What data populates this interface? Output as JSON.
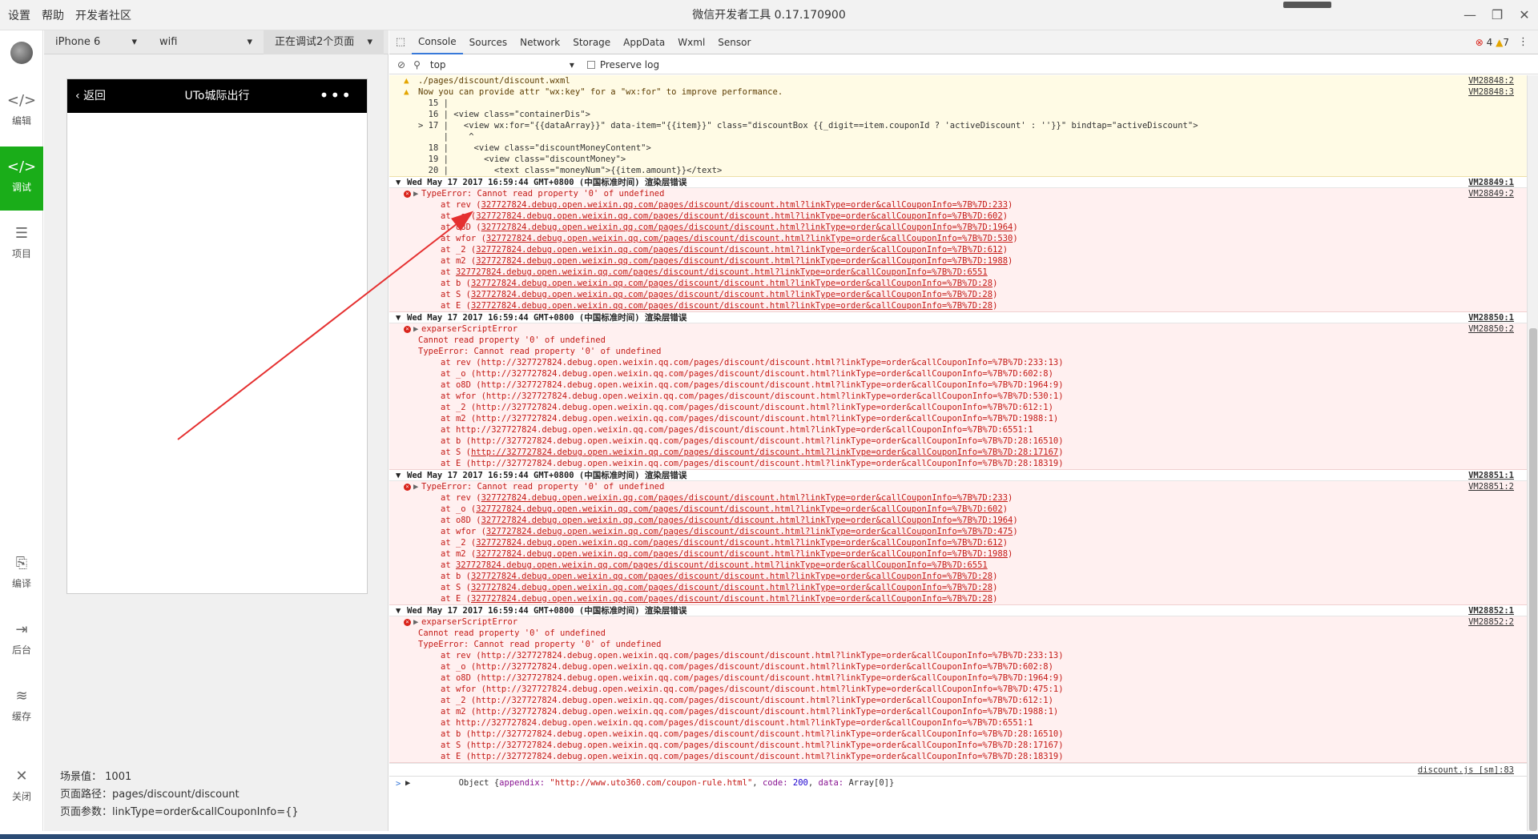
{
  "titlebar": {
    "menu": [
      "设置",
      "帮助",
      "开发者社区"
    ],
    "title": "微信开发者工具 0.17.170900"
  },
  "sidebar": {
    "items": [
      {
        "label": "编辑",
        "icon": "code-icon"
      },
      {
        "label": "调试",
        "icon": "debug-icon",
        "active": true
      },
      {
        "label": "项目",
        "icon": "menu-icon"
      },
      {
        "label": "编译",
        "icon": "compile-icon"
      },
      {
        "label": "后台",
        "icon": "background-icon"
      },
      {
        "label": "缓存",
        "icon": "layers-icon"
      },
      {
        "label": "关闭",
        "icon": "close-icon"
      }
    ]
  },
  "simulator": {
    "device": "iPhone 6",
    "network": "wifi",
    "debug_pages": "正在调试2个页面",
    "nav_back": "返回",
    "nav_title": "UTo城际出行",
    "nav_more": "•••",
    "scene_label": "场景值：",
    "scene_value": "1001",
    "path_label": "页面路径：",
    "path_value": "pages/discount/discount",
    "params_label": "页面参数：",
    "params_value": "linkType=order&callCouponInfo={}"
  },
  "devtools": {
    "tabs": [
      "Console",
      "Sources",
      "Network",
      "Storage",
      "AppData",
      "Wxml",
      "Sensor"
    ],
    "errors": "4",
    "warnings": "7",
    "filter_context": "top",
    "preserve_log": "Preserve log"
  },
  "console": {
    "warn_file": "./pages/discount/discount.wxml",
    "warn_src1": "VM28848:2",
    "warn_msg": "Now you can provide attr \"wx:key\" for a \"wx:for\" to improve performance.",
    "warn_src2": "VM28848:3",
    "code": [
      "  15 |",
      "  16 | <view class=\"containerDis\">",
      "> 17 |   <view wx:for=\"{{dataArray}}\" data-item=\"{{item}}\" class=\"discountBox {{_digit==item.couponId ? 'activeDiscount' : ''}}\" bindtap=\"activeDiscount\">",
      "     |    ^",
      "  18 |     <view class=\"discountMoneyContent\">",
      "  19 |       <view class=\"discountMoney\">",
      "  20 |         <text class=\"moneyNum\">{{item.amount}}</text>"
    ],
    "groups": [
      {
        "header": "Wed May 17 2017 16:59:44 GMT+0800 (中国标准时间) 渲染层错误",
        "hsrc": "VM28849:1",
        "esrc": "VM28849:2",
        "title": "TypeError: Cannot read property '0' of undefined",
        "extra": [],
        "stack": [
          [
            "at rev (",
            "327727824.debug.open.weixin.qq.com/pages/discount/discount.html?linkType=order&callCouponInfo=%7B%7D:233",
            ")"
          ],
          [
            "at _o (",
            "327727824.debug.open.weixin.qq.com/pages/discount/discount.html?linkType=order&callCouponInfo=%7B%7D:602",
            ")"
          ],
          [
            "at o8D (",
            "327727824.debug.open.weixin.qq.com/pages/discount/discount.html?linkType=order&callCouponInfo=%7B%7D:1964",
            ")"
          ],
          [
            "at wfor (",
            "327727824.debug.open.weixin.qq.com/pages/discount/discount.html?linkType=order&callCouponInfo=%7B%7D:530",
            ")"
          ],
          [
            "at _2 (",
            "327727824.debug.open.weixin.qq.com/pages/discount/discount.html?linkType=order&callCouponInfo=%7B%7D:612",
            ")"
          ],
          [
            "at m2 (",
            "327727824.debug.open.weixin.qq.com/pages/discount/discount.html?linkType=order&callCouponInfo=%7B%7D:1988",
            ")"
          ],
          [
            "at ",
            "327727824.debug.open.weixin.qq.com/pages/discount/discount.html?linkType=order&callCouponInfo=%7B%7D:6551",
            ""
          ],
          [
            "at b (",
            "327727824.debug.open.weixin.qq.com/pages/discount/discount.html?linkType=order&callCouponInfo=%7B%7D:28",
            ")"
          ],
          [
            "at S (",
            "327727824.debug.open.weixin.qq.com/pages/discount/discount.html?linkType=order&callCouponInfo=%7B%7D:28",
            ")"
          ],
          [
            "at E (",
            "327727824.debug.open.weixin.qq.com/pages/discount/discount.html?linkType=order&callCouponInfo=%7B%7D:28",
            ")"
          ]
        ]
      },
      {
        "header": "Wed May 17 2017 16:59:44 GMT+0800 (中国标准时间) 渲染层错误",
        "hsrc": "VM28850:1",
        "esrc": "VM28850:2",
        "title": "exparserScriptError",
        "extra": [
          "Cannot read property '0' of undefined",
          "TypeError: Cannot read property '0' of undefined"
        ],
        "stack": [
          [
            "at rev (http://327727824.debug.open.weixin.qq.com/pages/discount/discount.html?linkType=order&callCouponInfo=%7B%7D:233:13)",
            "",
            ""
          ],
          [
            "at _o (http://327727824.debug.open.weixin.qq.com/pages/discount/discount.html?linkType=order&callCouponInfo=%7B%7D:602:8)",
            "",
            ""
          ],
          [
            "at o8D (http://327727824.debug.open.weixin.qq.com/pages/discount/discount.html?linkType=order&callCouponInfo=%7B%7D:1964:9)",
            "",
            ""
          ],
          [
            "at wfor (http://327727824.debug.open.weixin.qq.com/pages/discount/discount.html?linkType=order&callCouponInfo=%7B%7D:530:1)",
            "",
            ""
          ],
          [
            "at _2 (http://327727824.debug.open.weixin.qq.com/pages/discount/discount.html?linkType=order&callCouponInfo=%7B%7D:612:1)",
            "",
            ""
          ],
          [
            "at m2 (http://327727824.debug.open.weixin.qq.com/pages/discount/discount.html?linkType=order&callCouponInfo=%7B%7D:1988:1)",
            "",
            ""
          ],
          [
            "at http://327727824.debug.open.weixin.qq.com/pages/discount/discount.html?linkType=order&callCouponInfo=%7B%7D:6551:1",
            "",
            ""
          ],
          [
            "at b (http://327727824.debug.open.weixin.qq.com/pages/discount/discount.html?linkType=order&callCouponInfo=%7B%7D:28:16510)",
            "",
            ""
          ],
          [
            "at S (",
            "http://327727824.debug.open.weixin.qq.com/pages/discount/discount.html?linkType=order&callCouponInfo=%7B%7D:28:17167",
            ")"
          ],
          [
            "at E (http://327727824.debug.open.weixin.qq.com/pages/discount/discount.html?linkType=order&callCouponInfo=%7B%7D:28:18319)",
            "",
            ""
          ]
        ]
      },
      {
        "header": "Wed May 17 2017 16:59:44 GMT+0800 (中国标准时间) 渲染层错误",
        "hsrc": "VM28851:1",
        "esrc": "VM28851:2",
        "title": "TypeError: Cannot read property '0' of undefined",
        "extra": [],
        "stack": [
          [
            "at rev (",
            "327727824.debug.open.weixin.qq.com/pages/discount/discount.html?linkType=order&callCouponInfo=%7B%7D:233",
            ")"
          ],
          [
            "at _o (",
            "327727824.debug.open.weixin.qq.com/pages/discount/discount.html?linkType=order&callCouponInfo=%7B%7D:602",
            ")"
          ],
          [
            "at o8D (",
            "327727824.debug.open.weixin.qq.com/pages/discount/discount.html?linkType=order&callCouponInfo=%7B%7D:1964",
            ")"
          ],
          [
            "at wfor (",
            "327727824.debug.open.weixin.qq.com/pages/discount/discount.html?linkType=order&callCouponInfo=%7B%7D:475",
            ")"
          ],
          [
            "at _2 (",
            "327727824.debug.open.weixin.qq.com/pages/discount/discount.html?linkType=order&callCouponInfo=%7B%7D:612",
            ")"
          ],
          [
            "at m2 (",
            "327727824.debug.open.weixin.qq.com/pages/discount/discount.html?linkType=order&callCouponInfo=%7B%7D:1988",
            ")"
          ],
          [
            "at ",
            "327727824.debug.open.weixin.qq.com/pages/discount/discount.html?linkType=order&callCouponInfo=%7B%7D:6551",
            ""
          ],
          [
            "at b (",
            "327727824.debug.open.weixin.qq.com/pages/discount/discount.html?linkType=order&callCouponInfo=%7B%7D:28",
            ")"
          ],
          [
            "at S (",
            "327727824.debug.open.weixin.qq.com/pages/discount/discount.html?linkType=order&callCouponInfo=%7B%7D:28",
            ")"
          ],
          [
            "at E (",
            "327727824.debug.open.weixin.qq.com/pages/discount/discount.html?linkType=order&callCouponInfo=%7B%7D:28",
            ")"
          ]
        ]
      },
      {
        "header": "Wed May 17 2017 16:59:44 GMT+0800 (中国标准时间) 渲染层错误",
        "hsrc": "VM28852:1",
        "esrc": "VM28852:2",
        "title": "exparserScriptError",
        "extra": [
          "Cannot read property '0' of undefined",
          "TypeError: Cannot read property '0' of undefined"
        ],
        "stack": [
          [
            "at rev (http://327727824.debug.open.weixin.qq.com/pages/discount/discount.html?linkType=order&callCouponInfo=%7B%7D:233:13)",
            "",
            ""
          ],
          [
            "at _o (http://327727824.debug.open.weixin.qq.com/pages/discount/discount.html?linkType=order&callCouponInfo=%7B%7D:602:8)",
            "",
            ""
          ],
          [
            "at o8D (http://327727824.debug.open.weixin.qq.com/pages/discount/discount.html?linkType=order&callCouponInfo=%7B%7D:1964:9)",
            "",
            ""
          ],
          [
            "at wfor (http://327727824.debug.open.weixin.qq.com/pages/discount/discount.html?linkType=order&callCouponInfo=%7B%7D:475:1)",
            "",
            ""
          ],
          [
            "at _2 (http://327727824.debug.open.weixin.qq.com/pages/discount/discount.html?linkType=order&callCouponInfo=%7B%7D:612:1)",
            "",
            ""
          ],
          [
            "at m2 (http://327727824.debug.open.weixin.qq.com/pages/discount/discount.html?linkType=order&callCouponInfo=%7B%7D:1988:1)",
            "",
            ""
          ],
          [
            "at http://327727824.debug.open.weixin.qq.com/pages/discount/discount.html?linkType=order&callCouponInfo=%7B%7D:6551:1",
            "",
            ""
          ],
          [
            "at b (http://327727824.debug.open.weixin.qq.com/pages/discount/discount.html?linkType=order&callCouponInfo=%7B%7D:28:16510)",
            "",
            ""
          ],
          [
            "at S (http://327727824.debug.open.weixin.qq.com/pages/discount/discount.html?linkType=order&callCouponInfo=%7B%7D:28:17167)",
            "",
            ""
          ],
          [
            "at E (http://327727824.debug.open.weixin.qq.com/pages/discount/discount.html?linkType=order&callCouponInfo=%7B%7D:28:18319)",
            "",
            ""
          ]
        ]
      }
    ],
    "object_line": {
      "prefix": "Object",
      "open": "{",
      "k1": "appendix:",
      "v1": "\"http://www.uto360.com/coupon-rule.html\"",
      "k2": "code:",
      "v2": "200",
      "k3": "data:",
      "v3": "Array[0]",
      "close": "}",
      "src": "discount.js [sm]:83"
    },
    "prompt": ">"
  }
}
